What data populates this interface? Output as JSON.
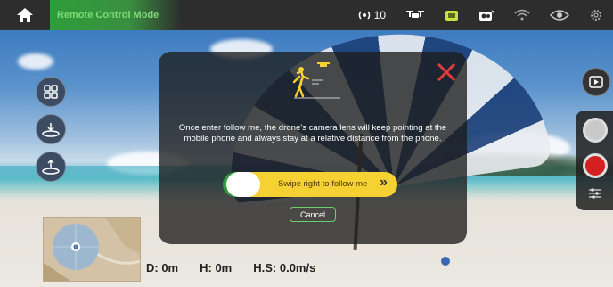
{
  "topbar": {
    "mode_label": "Remote Control Mode",
    "signal_value": "10"
  },
  "dialog": {
    "message": "Once enter follow me, the drone's camera lens will keep pointing at the mobile phone and always stay at a relative distance from the phone.",
    "slider_label": "Swipe right to follow me",
    "slider_chevrons": "»",
    "cancel_label": "Cancel"
  },
  "telemetry": {
    "distance": "D: 0m",
    "height": "H: 0m",
    "hspeed": "H.S: 0.0m/s"
  },
  "icons": {
    "home": "home-icon",
    "signal": "signal-icon",
    "drone": "drone-icon",
    "battery": "battery-icon",
    "camera": "camera-icon",
    "wifi": "wifi-icon",
    "eye": "eye-icon",
    "settings": "gear-icon",
    "close": "close-icon",
    "play": "play-icon",
    "sliders": "sliders-icon"
  },
  "colors": {
    "accent_green": "#2e9d3a",
    "slider_yellow": "#f5d133",
    "close_red": "#e23b3b",
    "record_red": "#d42020"
  }
}
